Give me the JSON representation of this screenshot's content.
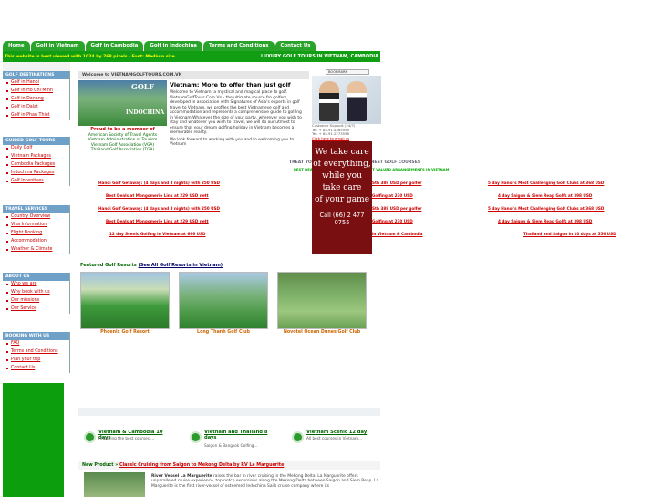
{
  "nav": {
    "tabs": [
      "Home",
      "Golf in Vietnam",
      "Golf in Cambodia",
      "Golf in Indochina",
      "Terms and Conditions",
      "Contact Us"
    ]
  },
  "topbar": {
    "note": "This website is best viewed with 1024 by 768 pixels · Font: Medium size",
    "tagline": "LUXURY GOLF TOURS IN VIETNAM, CAMBODIA"
  },
  "sidebar": {
    "sections": [
      {
        "title": "GOLF DESTINATIONS",
        "items": [
          "Golf in Hanoi",
          "Golf in Ho Chi Minh",
          "Golf in Danang",
          "Golf in Dalat",
          "Golf in Phan Thiet"
        ]
      },
      {
        "title": "GUIDED GOLF TOURS",
        "items": [
          "Daily Golf",
          "Vietnam Packages",
          "Cambodia Packages",
          "Indochina Packages",
          "Golf Incentives"
        ]
      },
      {
        "title": "TRAVEL SERVICES",
        "items": [
          "Country Overview",
          "Visa Information",
          "Flight Booking",
          "Accommodation",
          "Weather & Climate"
        ]
      },
      {
        "title": "ABOUT US",
        "items": [
          "Who we are",
          "Why book with us",
          "Our missions",
          "Our Service"
        ]
      },
      {
        "title": "BOOKING WITH US",
        "items": [
          "FAQ",
          "Terms and Conditions",
          "Plan your trip",
          "Contact Us"
        ]
      }
    ]
  },
  "welcome": {
    "bar": "Welcome to VIETNAMGOLFTOURS.COM.VN",
    "logo_top": "GOLF",
    "logo_bottom": "INDOCHINA",
    "heading": "Vietnam: More to offer than just golf",
    "body": "Welcome to Vietnam, a mystical and magical place to golf. VietnamGolfTours.Com.Vn - the ultimate source fro golfers, developed in association with Signatures of Asia's experts in golf travel to Vietnam, we profiles the best Vietnamese golf and accommodation and represents a comprehensive guide to golfing in Vietnam Whatever the size of your party, wherever you wish to stay and whatever you wish to travel, we will do our utmost to ensure that your dream golfing holiday in Vietnam becomes a memorable reality.",
    "body2": "We look forward to working with you and to welcoming you to Vietnam"
  },
  "member": {
    "title": "Proud to be a member of",
    "orgs": [
      "American Society of Travel Agents",
      "Vietnam Administration of Tourism",
      "Vietnam Golf Association (VGA)",
      "Thailand Golf Association (TGA)"
    ]
  },
  "bookmark": "BOOKMARK",
  "support": {
    "title": "Customer Support (24/7)",
    "tel": "Tel: + 84.91.4565959",
    "tel2": "Tel: + 84.91.2273556",
    "link": "Click here to email us"
  },
  "promo": {
    "lines": [
      "We take care",
      "of everything,",
      "while you",
      "take care",
      "of your game"
    ],
    "call": "Call (66) 2 477 0755"
  },
  "treat": {
    "heading": "TREAT YOURSELF TO VIETNAM'S FINEST GOLF COURSES",
    "sub": "BEST DEALS ON GOLF PACKAGES AT BEST VALUED ARRANGEMENTS IN VIETNAM"
  },
  "tours_left": [
    "Hanoi Golf Getaway: (4 days and 3 nights) with 250 USD",
    "Best Deals at Mongomerie Link at 229 USD nett",
    "Hanoi Golf Getaway: (4 days and 3 nights) with 250 USD",
    "Best Deals at Mongomerie Link at 229 USD nett",
    "12 day Scenic Golfing in Vietnam at 666 USD"
  ],
  "tours_mid": [
    "Sth 389 USD per golfer",
    "Golfing at 230 USD",
    "Sth 389 USD per golfer",
    "Golfing at 230 USD",
    "in Vietnam & Cambodia"
  ],
  "tours_right": [
    "5 day Hanoi's Most Challenging Golf Clubs at 368 USD",
    "4 day Saigon & Siem Reap Golfs at 398 USD",
    "5 day Hanoi's Most Challenging Golf Clubs at 368 USD",
    "4 day Saigon & Siem Reap Golfs at 398 USD",
    "Thailand and Saigon in 10 days at 556 USD"
  ],
  "featured": {
    "label": "Featured Golf Resorts",
    "link": "(See All Golf Resorts in Vietnam)",
    "resorts": [
      "Phoenix Golf Resort",
      "Long Thanh Golf Club",
      "Novotel Ocean Dunes Golf Club"
    ]
  },
  "packages": [
    {
      "title": "Vietnam & Cambodia 10 days",
      "desc": "Featuring the best courses ..."
    },
    {
      "title": "Vietnam and Thailand 8 days",
      "desc": "Saigon & Bangkok Golfing..."
    },
    {
      "title": "Vietnam Scenic 12 day",
      "desc": "All best courses in Vietnam..."
    }
  ],
  "newproduct": {
    "label": "New Product »",
    "link": "Classic Cruising from Saigon to Mekong Delta by RV La Marguerite",
    "name": "River Vessel La Marguerite",
    "text": "raises the bar in river cruising in the Mekong Delta. La Marguerite offers unparalleled cruise experience, top notch excursions along the Mekong Delta between Saigon and Siem Reap. La Marguerite is the first river-vessel of esteemed Indochina Sails cruise company where its"
  },
  "colors": {
    "nav_green": "#2aa32a",
    "bar_green": "#129e12",
    "section_blue": "#6fa0c8",
    "promo_red": "#7a0f12",
    "link_red": "#cc0000"
  }
}
